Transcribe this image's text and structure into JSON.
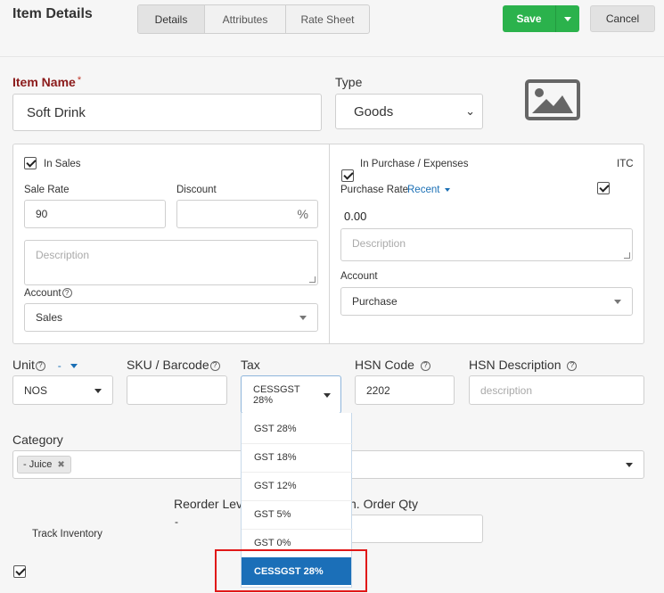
{
  "header": {
    "title": "Item Details",
    "tabs": [
      "Details",
      "Attributes",
      "Rate Sheet"
    ],
    "save_label": "Save",
    "cancel_label": "Cancel"
  },
  "item": {
    "name_label": "Item Name",
    "required_mark": "*",
    "name_value": "Soft Drink",
    "type_label": "Type",
    "type_value": "Goods"
  },
  "sales": {
    "checkbox_label": "In Sales",
    "sale_rate_label": "Sale Rate",
    "sale_rate_value": "90",
    "discount_label": "Discount",
    "discount_value": "",
    "percent_symbol": "%",
    "description_placeholder": "Description",
    "account_label": "Account",
    "account_value": "Sales"
  },
  "purchase": {
    "checkbox_label": "In Purchase / Expenses",
    "itc_label": "ITC",
    "rate_label": "Purchase Rate",
    "recent_label": "Recent",
    "rate_value": "0.00",
    "description_placeholder": "Description",
    "account_label": "Account",
    "account_value": "Purchase"
  },
  "details": {
    "unit_label": "Unit",
    "unit_dash": "-",
    "unit_value": "NOS",
    "sku_label": "SKU / Barcode",
    "sku_value": "",
    "tax_label": "Tax",
    "tax_value": "CESSGST 28%",
    "hsn_code_label": "HSN Code",
    "hsn_code_value": "2202",
    "hsn_desc_label": "HSN Description",
    "hsn_desc_placeholder": "description",
    "help_glyph": "?"
  },
  "tax_options": [
    "GST 28%",
    "GST 18%",
    "GST 12%",
    "GST 5%",
    "GST 0%"
  ],
  "tax_selected_option": "CESSGST 28%",
  "category": {
    "label": "Category",
    "tag": "- Juice",
    "tag_remove": "✖"
  },
  "inventory": {
    "track_label": "Track Inventory",
    "reorder_label": "Reorder Lev",
    "reorder_value": "-",
    "min_order_label": "n. Order Qty"
  },
  "colors": {
    "save": "#2bb24c",
    "required_label": "#8b1a1a",
    "link": "#1a6fb5",
    "selected_option": "#1b6fb8",
    "highlight_box": "#e01818"
  }
}
